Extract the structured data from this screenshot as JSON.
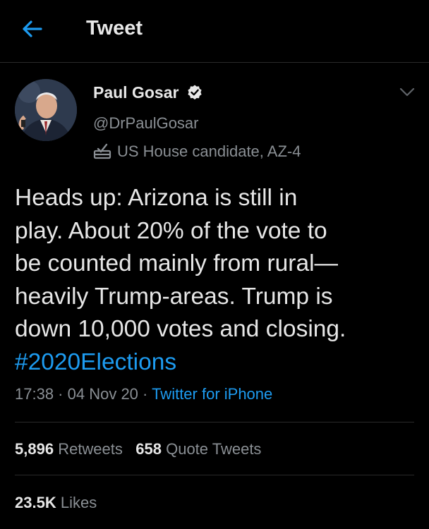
{
  "header": {
    "title": "Tweet",
    "back_icon": "arrow-left-icon",
    "back_icon_color": "#1d9bf0"
  },
  "author": {
    "name": "Paul Gosar",
    "handle": "@DrPaulGosar",
    "verified_icon": "verified-badge-icon",
    "label_icon": "ballot-box-icon",
    "label": "US House candidate, AZ-4",
    "menu_icon": "chevron-down-icon"
  },
  "tweet": {
    "lines": [
      "Heads up:  Arizona is still in",
      "play.  About 20% of the vote to",
      "be counted mainly from rural—",
      "heavily Trump-areas.  Trump is",
      "down 10,000 votes and closing."
    ],
    "hashtag": "#2020Elections",
    "time": "17:38",
    "date": "04 Nov 20",
    "separator": " · ",
    "source": "Twitter for iPhone"
  },
  "stats": {
    "retweets_count": "5,896",
    "retweets_label": "Retweets",
    "quotes_count": "658",
    "quotes_label": "Quote Tweets",
    "likes_count": "23.5K",
    "likes_label": "Likes"
  },
  "colors": {
    "background": "#000000",
    "accent": "#1d9bf0",
    "muted": "#8a8f94",
    "text": "#e6e6e6"
  }
}
